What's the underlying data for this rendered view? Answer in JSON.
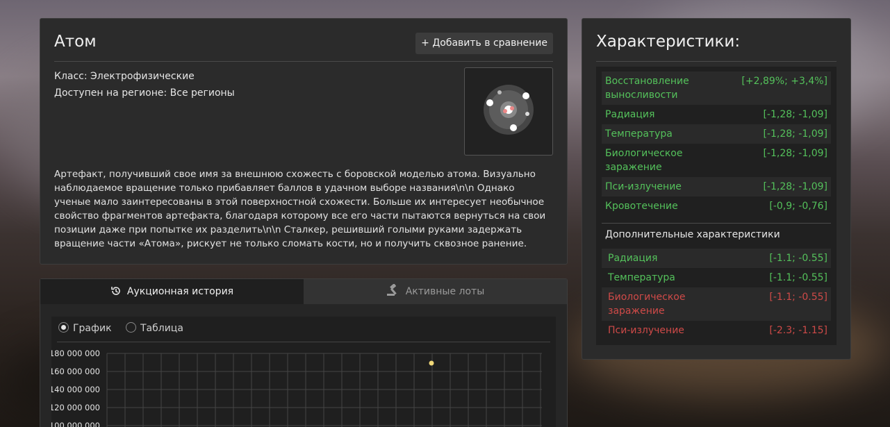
{
  "artifact": {
    "title": "Атом",
    "add_compare_label": "Добавить в сравнение",
    "class_line": "Класс: Электрофизические",
    "region_line": "Доступен на регионе: Все регионы",
    "description": "Артефакт, получивший свое имя за внешнюю схожесть с боровской моделью атома. Визуально наблюдаемое вращение только прибавляет баллов в удачном выборе названия\\n\\n Однако ученые мало заинтересованы в этой поверхностной схожести. Больше их интересует необычное свойство фрагментов артефакта, благодаря которому все его части пытаются вернуться на свои позиции даже при попытке их разделить\\n\\n Сталкер, решивший голыми руками задержать вращение части «Атома», рискует не только сломать кости, но и получить сквозное ранение."
  },
  "tabs": {
    "history": "Аукционная история",
    "lots": "Активные лоты"
  },
  "view_toggle": {
    "chart": "График",
    "table": "Таблица",
    "selected": "chart"
  },
  "chart_data": {
    "type": "scatter",
    "title": "",
    "xlabel": "",
    "ylabel": "",
    "y_ticks": [
      "180 000 000",
      "160 000 000",
      "140 000 000",
      "120 000 000",
      "100 000 000"
    ],
    "ylim": [
      100000000,
      180000000
    ],
    "grid": true,
    "points": [
      {
        "y": 170000000,
        "color": "#f0d878"
      }
    ]
  },
  "stats": {
    "title": "Характеристики:",
    "main": [
      {
        "name": "Восстановление выносливости",
        "value": "[+2,89%; +3,4%]",
        "tone": "green"
      },
      {
        "name": "Радиация",
        "value": "[-1,28; -1,09]",
        "tone": "green"
      },
      {
        "name": "Температура",
        "value": "[-1,28; -1,09]",
        "tone": "green"
      },
      {
        "name": "Биологическое заражение",
        "value": "[-1,28; -1,09]",
        "tone": "green"
      },
      {
        "name": "Пси-излучение",
        "value": "[-1,28; -1,09]",
        "tone": "green"
      },
      {
        "name": "Кровотечение",
        "value": "[-0,9; -0,76]",
        "tone": "green"
      }
    ],
    "additional_title": "Дополнительные характеристики",
    "additional": [
      {
        "name": "Радиация",
        "value": "[-1.1; -0.55]",
        "tone": "green"
      },
      {
        "name": "Температура",
        "value": "[-1.1; -0.55]",
        "tone": "green"
      },
      {
        "name": "Биологическое заражение",
        "value": "[-1.1; -0.55]",
        "tone": "red"
      },
      {
        "name": "Пси-излучение",
        "value": "[-2.3; -1.15]",
        "tone": "red"
      }
    ]
  },
  "colors": {
    "green": "#54c15b",
    "red": "#cf4a48"
  }
}
